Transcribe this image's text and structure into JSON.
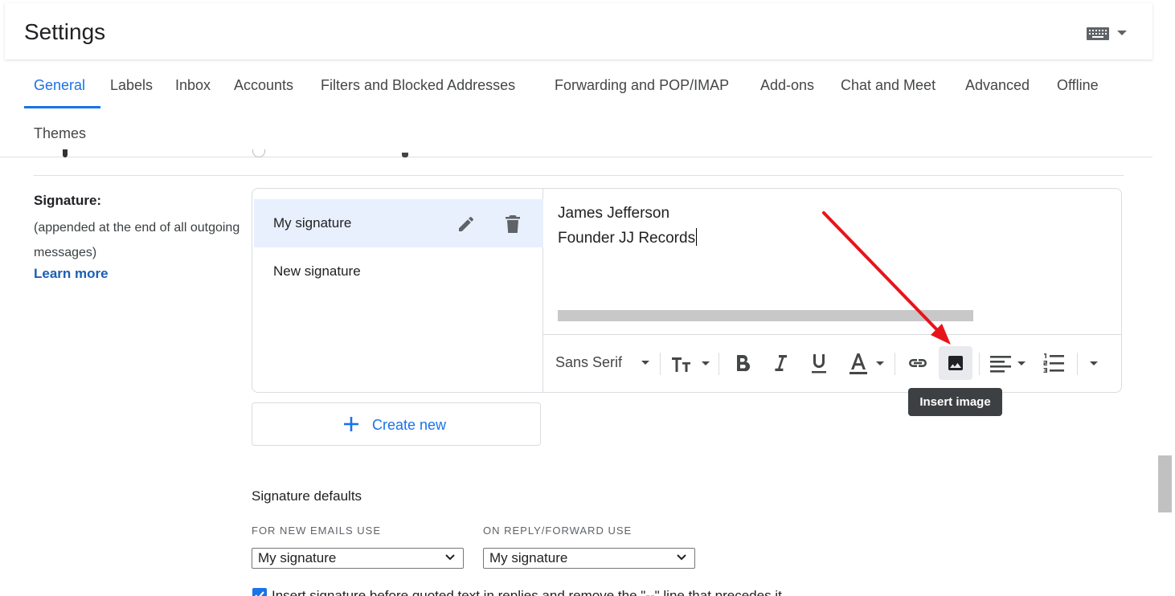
{
  "header": {
    "title": "Settings",
    "input_tools_icon": "keyboard-icon"
  },
  "tabs": [
    {
      "label": "General",
      "active": true
    },
    {
      "label": "Labels"
    },
    {
      "label": "Inbox"
    },
    {
      "label": "Accounts"
    },
    {
      "label": "Filters and Blocked Addresses"
    },
    {
      "label": "Forwarding and POP/IMAP"
    },
    {
      "label": "Add-ons"
    },
    {
      "label": "Chat and Meet"
    },
    {
      "label": "Advanced"
    },
    {
      "label": "Offline"
    },
    {
      "label": "Themes"
    }
  ],
  "signature": {
    "label": "Signature:",
    "description": "(appended at the end of all outgoing messages)",
    "learn_more": "Learn more",
    "list": [
      {
        "name": "My signature",
        "selected": true
      },
      {
        "name": "New signature"
      }
    ],
    "editor_lines": [
      "James Jefferson",
      "Founder JJ Records"
    ],
    "toolbar": {
      "font": "Sans Serif",
      "tooltip": "Insert image"
    },
    "create_new": "Create new"
  },
  "defaults": {
    "title": "Signature defaults",
    "new_label": "FOR NEW EMAILS USE",
    "new_value": "My signature",
    "reply_label": "ON REPLY/FORWARD USE",
    "reply_value": "My signature",
    "checkbox_text": "Insert signature before quoted text in replies and remove the \"--\" line that precedes it."
  },
  "colors": {
    "accent": "#1a73e8",
    "annotation_arrow": "#e8141b",
    "selected_bg": "#e8f0fe"
  }
}
